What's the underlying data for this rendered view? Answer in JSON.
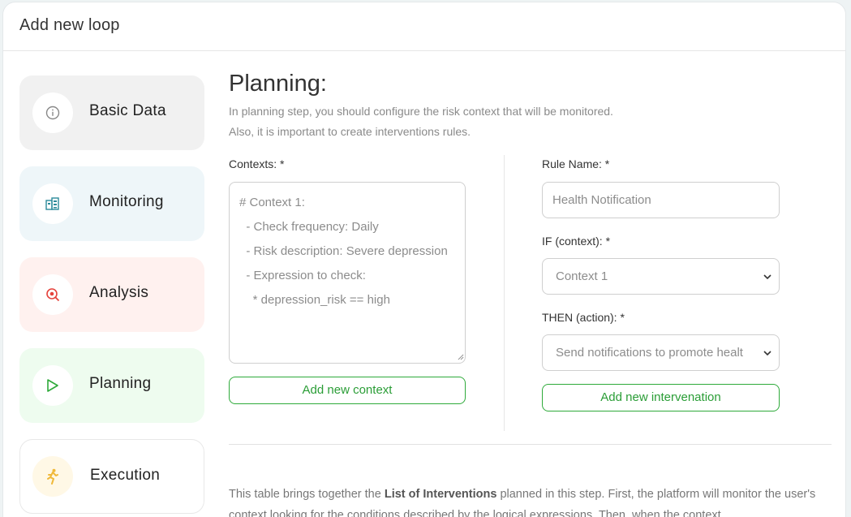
{
  "dialog": {
    "title": "Add new loop"
  },
  "steps": [
    {
      "label": "Basic Data",
      "icon": "info-icon",
      "color": "#888888"
    },
    {
      "label": "Monitoring",
      "icon": "monitoring-icon",
      "color": "#2b8a9a"
    },
    {
      "label": "Analysis",
      "icon": "analysis-icon",
      "color": "#e5433c"
    },
    {
      "label": "Planning",
      "icon": "play-icon",
      "color": "#2eaa3a"
    },
    {
      "label": "Execution",
      "icon": "runner-icon",
      "color": "#f0b93a"
    }
  ],
  "planning": {
    "title": "Planning:",
    "description_line1": "In planning step, you should configure the risk context that will be monitored.",
    "description_line2": "Also, it is important to create interventions rules.",
    "contexts_label": "Contexts: *",
    "contexts_value": "# Context 1:\n  - Check frequency: Daily\n  - Risk description: Severe depression\n  - Expression to check:\n    * depression_risk == high",
    "add_context_label": "Add new context",
    "rule_name_label": "Rule Name: *",
    "rule_name_placeholder": "Health Notification",
    "if_label": "IF (context): *",
    "if_value": "Context 1",
    "then_label": "THEN (action): *",
    "then_value": "Send notifications to promote healt",
    "add_intervention_label": "Add new intervenation"
  },
  "footer": {
    "text_before": "This table brings together the ",
    "text_bold": "List of Interventions",
    "text_after": " planned in this step. First, the platform will monitor the user's context looking for the conditions described by the logical expressions. Then, when the context"
  },
  "colors": {
    "accent": "#2eaa3a",
    "background": "#eef3f4"
  }
}
